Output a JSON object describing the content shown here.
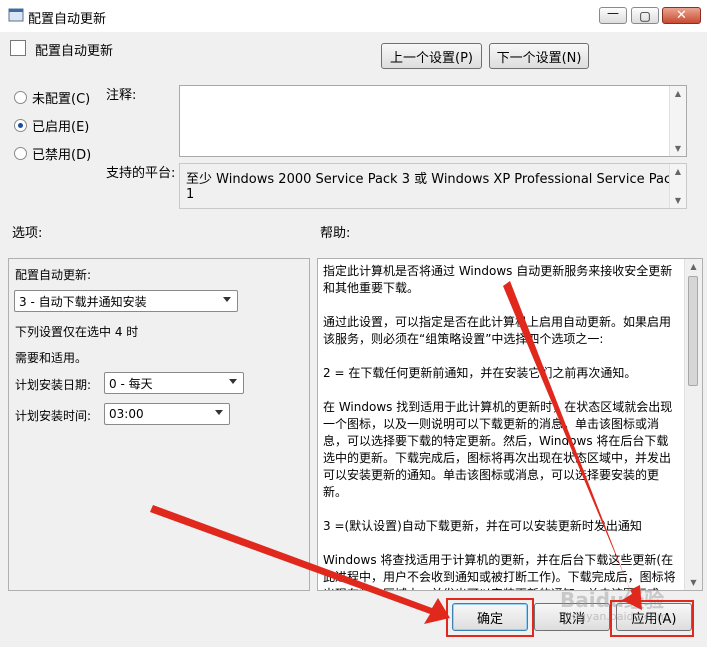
{
  "window": {
    "title": "配置自动更新",
    "controls": {
      "minimize": "—",
      "maximize": "▢",
      "close": "✕"
    }
  },
  "header": {
    "title": "配置自动更新",
    "prev_setting": "上一个设置(P)",
    "next_setting": "下一个设置(N)"
  },
  "state_options": [
    {
      "label": "未配置(C)",
      "selected": false
    },
    {
      "label": "已启用(E)",
      "selected": true
    },
    {
      "label": "已禁用(D)",
      "selected": false
    }
  ],
  "comment": {
    "label": "注释:",
    "value": ""
  },
  "platform": {
    "label": "支持的平台:",
    "value": "至少 Windows 2000 Service Pack 3 或 Windows XP Professional Service Pack 1"
  },
  "options": {
    "label": "选项:",
    "configure_label": "配置自动更新:",
    "configure_value": "3 - 自动下载并通知安装",
    "note_line1": "下列设置仅在选中 4 时",
    "note_line2": "需要和适用。",
    "install_day_label": "计划安装日期:",
    "install_day_value": "0 - 每天",
    "install_time_label": "计划安装时间:",
    "install_time_value": "03:00"
  },
  "help": {
    "label": "帮助:",
    "paragraphs": [
      "指定此计算机是否将通过 Windows 自动更新服务来接收安全更新和其他重要下载。",
      "通过此设置，可以指定是否在此计算机上启用自动更新。如果启用该服务，则必须在“组策略设置”中选择四个选项之一:",
      "2 = 在下载任何更新前通知，并在安装它们之前再次通知。",
      "在 Windows 找到适用于此计算机的更新时，在状态区域就会出现一个图标，以及一则说明可以下载更新的消息。单击该图标或消息，可以选择要下载的特定更新。然后，Windows 将在后台下载选中的更新。下载完成后，图标将再次出现在状态区域中，并发出可以安装更新的通知。单击该图标或消息，可以选择要安装的更新。",
      "3 =(默认设置)自动下载更新，并在可以安装更新时发出通知",
      "Windows 将查找适用于计算机的更新，并在后台下载这些更新(在此进程中，用户不会收到通知或被打断工作)。下载完成后，图标将出现在状态区域中，并发出可以安装更新的通知。单击该图标或"
    ]
  },
  "buttons": {
    "ok": "确定",
    "cancel": "取消",
    "apply": "应用(A)"
  },
  "watermark": {
    "logo": "Baidu经验",
    "url": "jingyan.baidu.com"
  },
  "colors": {
    "highlight": "#e0281c",
    "arrow": "#e0281c",
    "radio_dot": "#1a4fa0"
  }
}
